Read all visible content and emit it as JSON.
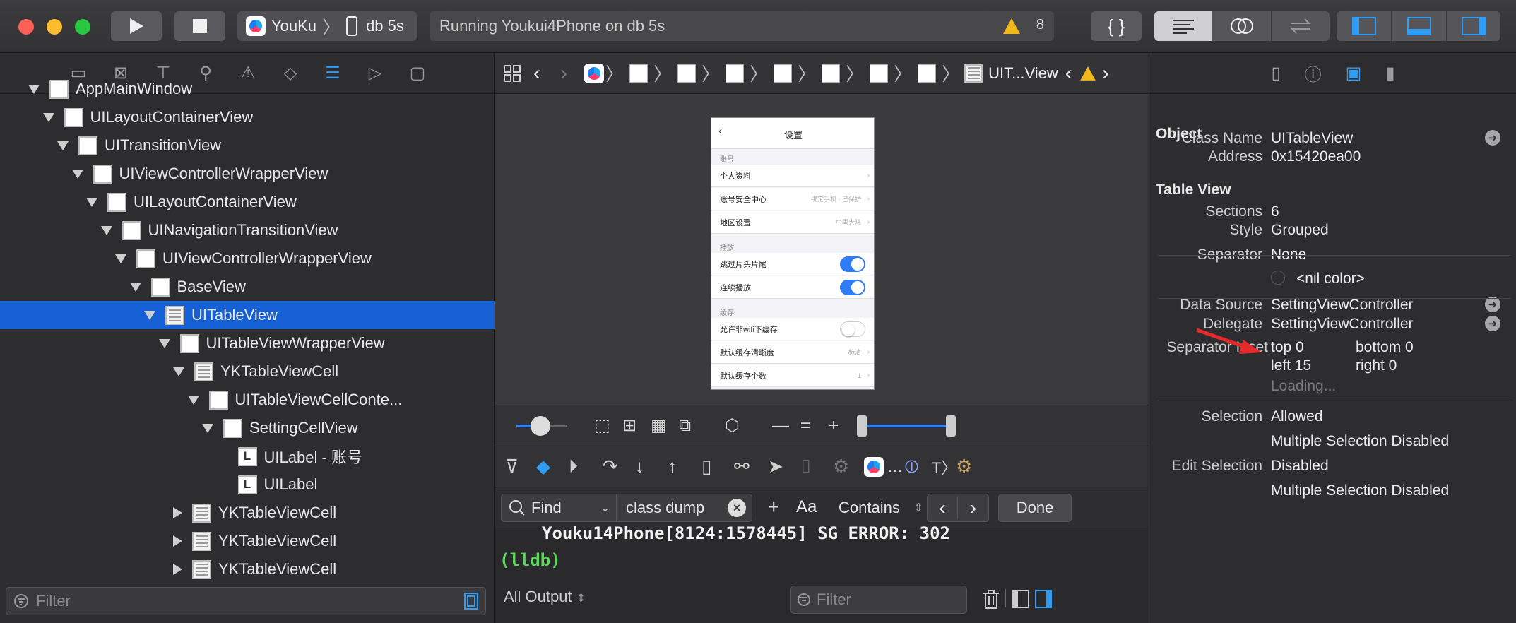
{
  "toolbar": {
    "scheme_app": "YouKu",
    "scheme_device": "db 5s",
    "activity_text": "Running Youkui4Phone on db 5s",
    "warning_count": "8",
    "braces_label": "{ }"
  },
  "navigator": {
    "tree": [
      {
        "label": "AppMainWindow",
        "indent": 0,
        "disclosure": "down",
        "icon": "view",
        "selected": false
      },
      {
        "label": "UILayoutContainerView",
        "indent": 1,
        "disclosure": "down",
        "icon": "view",
        "selected": false
      },
      {
        "label": "UITransitionView",
        "indent": 2,
        "disclosure": "down",
        "icon": "view",
        "selected": false
      },
      {
        "label": "UIViewControllerWrapperView",
        "indent": 3,
        "disclosure": "down",
        "icon": "view",
        "selected": false
      },
      {
        "label": "UILayoutContainerView",
        "indent": 4,
        "disclosure": "down",
        "icon": "view",
        "selected": false
      },
      {
        "label": "UINavigationTransitionView",
        "indent": 5,
        "disclosure": "down",
        "icon": "view",
        "selected": false
      },
      {
        "label": "UIViewControllerWrapperView",
        "indent": 6,
        "disclosure": "down",
        "icon": "view",
        "selected": false
      },
      {
        "label": "BaseView",
        "indent": 7,
        "disclosure": "down",
        "icon": "view",
        "selected": false
      },
      {
        "label": "UITableView",
        "indent": 8,
        "disclosure": "down",
        "icon": "table",
        "selected": true
      },
      {
        "label": "UITableViewWrapperView",
        "indent": 9,
        "disclosure": "down",
        "icon": "view",
        "selected": false
      },
      {
        "label": "YKTableViewCell",
        "indent": 10,
        "disclosure": "down",
        "icon": "table",
        "selected": false
      },
      {
        "label": "UITableViewCellConte...",
        "indent": 11,
        "disclosure": "down",
        "icon": "view",
        "selected": false
      },
      {
        "label": "SettingCellView",
        "indent": 12,
        "disclosure": "down",
        "icon": "view",
        "selected": false
      },
      {
        "label": "UILabel - 账号",
        "indent": 13,
        "disclosure": "none",
        "icon": "label",
        "selected": false
      },
      {
        "label": "UILabel",
        "indent": 13,
        "disclosure": "none",
        "icon": "label",
        "selected": false
      },
      {
        "label": "YKTableViewCell",
        "indent": 10,
        "disclosure": "right",
        "icon": "table",
        "selected": false
      },
      {
        "label": "YKTableViewCell",
        "indent": 10,
        "disclosure": "right",
        "icon": "table",
        "selected": false
      },
      {
        "label": "YKTableViewCell",
        "indent": 10,
        "disclosure": "right",
        "icon": "table",
        "selected": false
      }
    ],
    "filter_placeholder": "Filter"
  },
  "jumpbar": {
    "last_crumb": "UIT...View"
  },
  "phone": {
    "nav_title": "设置",
    "sections": [
      {
        "header": "账号",
        "rows": [
          {
            "label": "个人资料",
            "detail": "",
            "toggle": ""
          },
          {
            "label": "账号安全中心",
            "detail": "绑定手机 · 已保护",
            "toggle": ""
          },
          {
            "label": "地区设置",
            "detail": "中国大陆",
            "toggle": ""
          }
        ]
      },
      {
        "header": "播放",
        "rows": [
          {
            "label": "跳过片头片尾",
            "detail": "",
            "toggle": "on"
          },
          {
            "label": "连续播放",
            "detail": "",
            "toggle": "on"
          }
        ]
      },
      {
        "header": "缓存",
        "rows": [
          {
            "label": "允许非wifi下缓存",
            "detail": "",
            "toggle": "off"
          },
          {
            "label": "默认缓存清晰度",
            "detail": "标清",
            "toggle": ""
          },
          {
            "label": "默认缓存个数",
            "detail": "1",
            "toggle": ""
          }
        ]
      }
    ]
  },
  "find": {
    "mode": "Find",
    "query": "class dump",
    "case_label": "Aa",
    "match": "Contains",
    "done_label": "Done"
  },
  "console": {
    "line1": "Youku14Phone[8124:1578445] SG ERROR: 302",
    "prompt": "(lldb)",
    "output_selector": "All Output",
    "filter_placeholder": "Filter"
  },
  "inspector": {
    "object_title": "Object",
    "class_name_key": "Class Name",
    "class_name": "UITableView",
    "address_key": "Address",
    "address": "0x15420ea00",
    "tableview_title": "Table View",
    "sections_key": "Sections",
    "sections": "6",
    "style_key": "Style",
    "style": "Grouped",
    "separator_key": "Separator",
    "separator": "None",
    "separator_color": "<nil color>",
    "datasource_key": "Data Source",
    "datasource": "SettingViewController",
    "delegate_key": "Delegate",
    "delegate": "SettingViewController",
    "inset_key": "Separator Inset",
    "inset_top": "top  0",
    "inset_bottom": "bottom  0",
    "inset_left": "left  15",
    "inset_right": "right  0",
    "loading": "Loading...",
    "selection_key": "Selection",
    "selection": "Allowed",
    "multi_selection": "Multiple Selection Disabled",
    "edit_selection_key": "Edit Selection",
    "edit_selection": "Disabled",
    "edit_multi_selection": "Multiple Selection Disabled"
  },
  "colors": {
    "selection": "#1560d4",
    "accent_blue": "#2f7cf6",
    "warning": "#f3b81a",
    "arrow_red": "#e5292c"
  }
}
